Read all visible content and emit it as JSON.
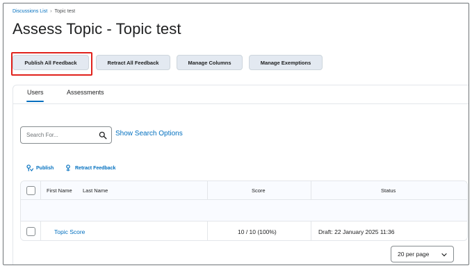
{
  "breadcrumb": {
    "parent": "Discussions List",
    "separator": "›",
    "current": "Topic test"
  },
  "page_title": "Assess Topic - Topic test",
  "toolbar": {
    "publish_all": "Publish All Feedback",
    "retract_all": "Retract All Feedback",
    "manage_columns": "Manage Columns",
    "manage_exemptions": "Manage Exemptions"
  },
  "tabs": [
    {
      "label": "Users",
      "selected": true
    },
    {
      "label": "Assessments",
      "selected": false
    }
  ],
  "search": {
    "placeholder": "Search For...",
    "options_link": "Show Search Options"
  },
  "actions": {
    "publish": "Publish",
    "retract": "Retract Feedback"
  },
  "grid": {
    "columns": {
      "first_name": "First Name",
      "last_name": "Last Name",
      "score": "Score",
      "status": "Status"
    },
    "rows": [
      {
        "name": "Topic Score",
        "score": "10 / 10 (100%)",
        "status": "Draft: 22 January 2025 11:36"
      }
    ]
  },
  "pager": {
    "per_page": "20 per page"
  },
  "colors": {
    "link": "#006fbf",
    "highlight": "#e0211b",
    "button_bg": "#e3e9f1"
  }
}
